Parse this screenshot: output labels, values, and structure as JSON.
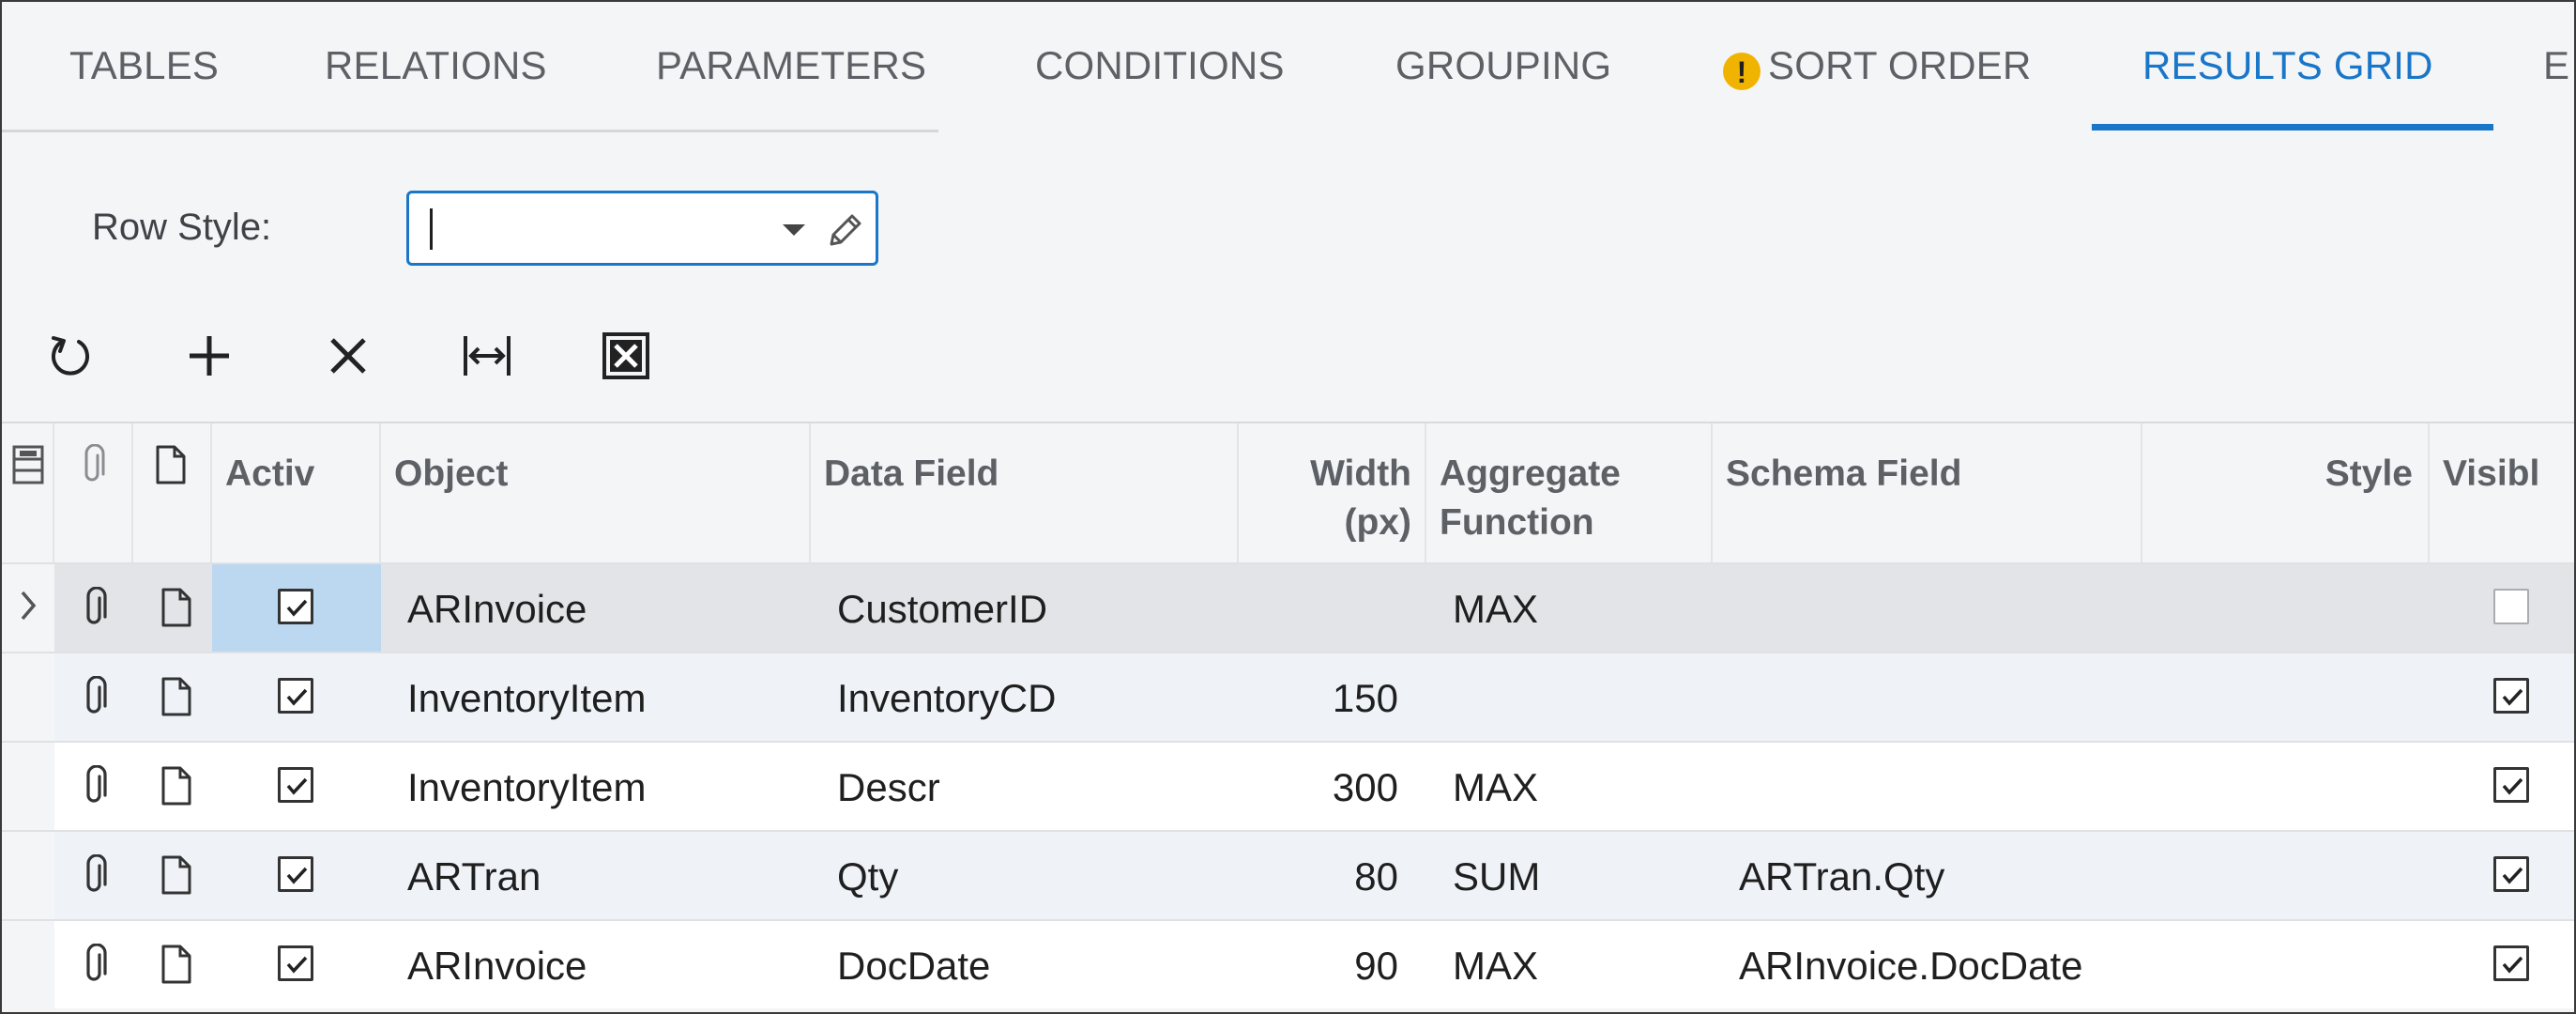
{
  "tabs": [
    {
      "label": "TABLES",
      "active": false,
      "warning": false
    },
    {
      "label": "RELATIONS",
      "active": false,
      "warning": false
    },
    {
      "label": "PARAMETERS",
      "active": false,
      "warning": false
    },
    {
      "label": "CONDITIONS",
      "active": false,
      "warning": false
    },
    {
      "label": "GROUPING",
      "active": false,
      "warning": false
    },
    {
      "label": "SORT ORDER",
      "active": false,
      "warning": true
    },
    {
      "label": "RESULTS GRID",
      "active": true,
      "warning": false
    },
    {
      "label": "E",
      "active": false,
      "warning": false
    }
  ],
  "warning_glyph": "!",
  "row_style": {
    "label": "Row Style:",
    "value": ""
  },
  "toolbar": [
    {
      "icon": "refresh-icon"
    },
    {
      "icon": "add-icon"
    },
    {
      "icon": "delete-icon"
    },
    {
      "icon": "fit-width-icon"
    },
    {
      "icon": "excel-export-icon"
    }
  ],
  "grid": {
    "columns": {
      "active": "Activ",
      "object": "Object",
      "data_field": "Data Field",
      "width_line1": "Width",
      "width_line2": "(px)",
      "aggregate_line1": "Aggregate",
      "aggregate_line2": "Function",
      "schema_field": "Schema Field",
      "style": "Style",
      "visible": "Visibl"
    },
    "rows": [
      {
        "active": true,
        "object": "ARInvoice",
        "data_field": "CustomerID",
        "width": "",
        "aggregate": "MAX",
        "schema_field": "",
        "style": "",
        "visible": false,
        "selected": true
      },
      {
        "active": true,
        "object": "InventoryItem",
        "data_field": "InventoryCD",
        "width": "150",
        "aggregate": "",
        "schema_field": "",
        "style": "",
        "visible": true,
        "selected": false
      },
      {
        "active": true,
        "object": "InventoryItem",
        "data_field": "Descr",
        "width": "300",
        "aggregate": "MAX",
        "schema_field": "",
        "style": "",
        "visible": true,
        "selected": false
      },
      {
        "active": true,
        "object": "ARTran",
        "data_field": "Qty",
        "width": "80",
        "aggregate": "SUM",
        "schema_field": "ARTran.Qty",
        "style": "",
        "visible": true,
        "selected": false
      },
      {
        "active": true,
        "object": "ARInvoice",
        "data_field": "DocDate",
        "width": "90",
        "aggregate": "MAX",
        "schema_field": "ARInvoice.DocDate",
        "style": "",
        "visible": true,
        "selected": false
      }
    ]
  },
  "colors": {
    "accent": "#1976c8",
    "warning": "#f0b400",
    "selected_row": "#e2e4e8",
    "selected_cell": "#bcd8f0",
    "alt_row": "#eff3f8"
  }
}
